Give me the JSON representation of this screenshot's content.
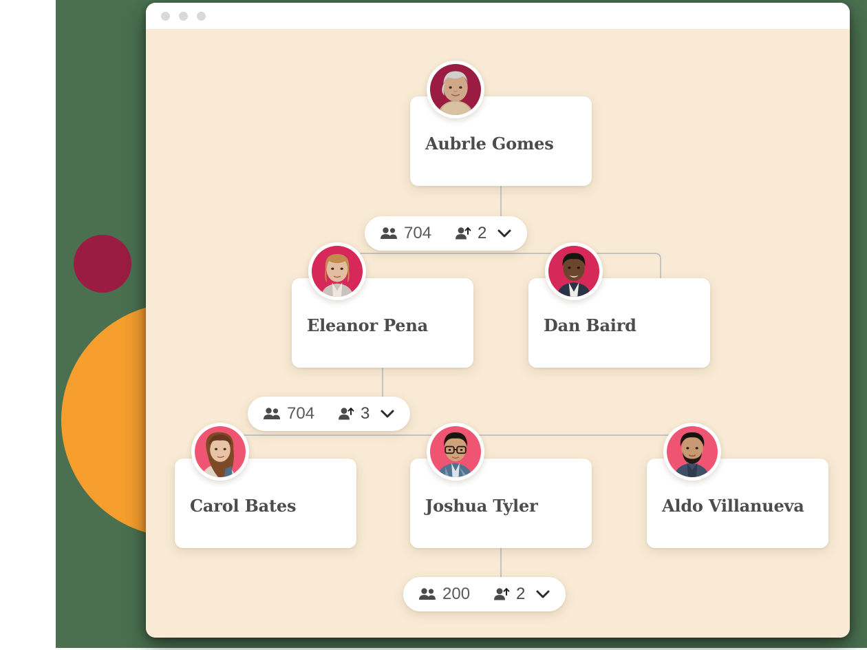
{
  "window": {
    "traffic_lights": [
      "close-dot",
      "minimize-dot",
      "maximize-dot"
    ]
  },
  "theme": {
    "backdrop_green": "#4a7050",
    "blob_maroon": "#9b1c42",
    "blob_orange": "#f79f2e",
    "canvas_cream": "#f8ead4",
    "card_white": "#ffffff",
    "text_dark": "#4c4c4c",
    "connector_gray": "#c3c3c3",
    "avatar_ring": "#ffffff"
  },
  "org_chart": {
    "levels": [
      {
        "level": 1,
        "nodes": [
          {
            "name": "Aubrle Gomes",
            "avatar_bg": "#9b1c42",
            "avatar": "avatar-aubrle-gomes"
          }
        ]
      },
      {
        "level": 2,
        "nodes": [
          {
            "name": "Eleanor Pena",
            "avatar_bg": "#d6295a",
            "avatar": "avatar-eleanor-pena"
          },
          {
            "name": "Dan Baird",
            "avatar_bg": "#d6295a",
            "avatar": "avatar-dan-baird"
          }
        ]
      },
      {
        "level": 3,
        "nodes": [
          {
            "name": "Carol Bates",
            "avatar_bg": "#ef5573",
            "avatar": "avatar-carol-bates"
          },
          {
            "name": "Joshua Tyler",
            "avatar_bg": "#ef5573",
            "avatar": "avatar-joshua-tyler"
          },
          {
            "name": "Aldo Villanueva",
            "avatar_bg": "#ef5573",
            "avatar": "avatar-aldo-villanueva"
          }
        ]
      }
    ],
    "pills": [
      {
        "id": "pill-level-1",
        "members_icon": "people-group-icon",
        "members_count": "704",
        "promotions_icon": "person-arrow-up-icon",
        "promotions_count": "2",
        "expand_icon": "chevron-down-icon"
      },
      {
        "id": "pill-level-2",
        "members_icon": "people-group-icon",
        "members_count": "704",
        "promotions_icon": "person-arrow-up-icon",
        "promotions_count": "3",
        "expand_icon": "chevron-down-icon"
      },
      {
        "id": "pill-level-3",
        "members_icon": "people-group-icon",
        "members_count": "200",
        "promotions_icon": "person-arrow-up-icon",
        "promotions_count": "2",
        "expand_icon": "chevron-down-icon"
      }
    ]
  }
}
